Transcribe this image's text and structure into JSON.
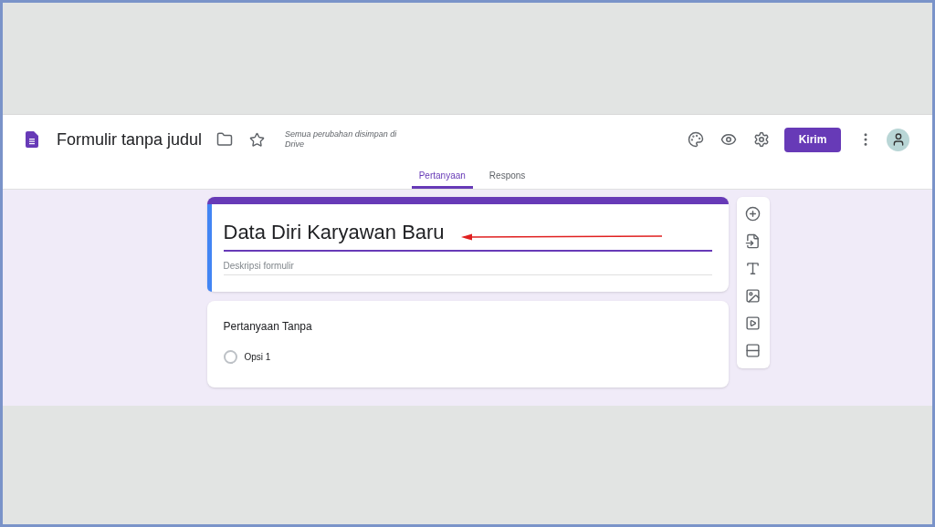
{
  "header": {
    "title": "Formulir tanpa judul",
    "save_status": "Semua perubahan disimpan di Drive",
    "send_button": "Kirim"
  },
  "tabs": [
    {
      "label": "Pertanyaan",
      "selected": true
    },
    {
      "label": "Respons",
      "selected": false
    }
  ],
  "form": {
    "title": "Data Diri Karyawan Baru",
    "description_placeholder": "Deskripsi formulir"
  },
  "question": {
    "title": "Pertanyaan Tanpa",
    "options": [
      {
        "label": "Opsi 1",
        "selected": false
      }
    ]
  }
}
